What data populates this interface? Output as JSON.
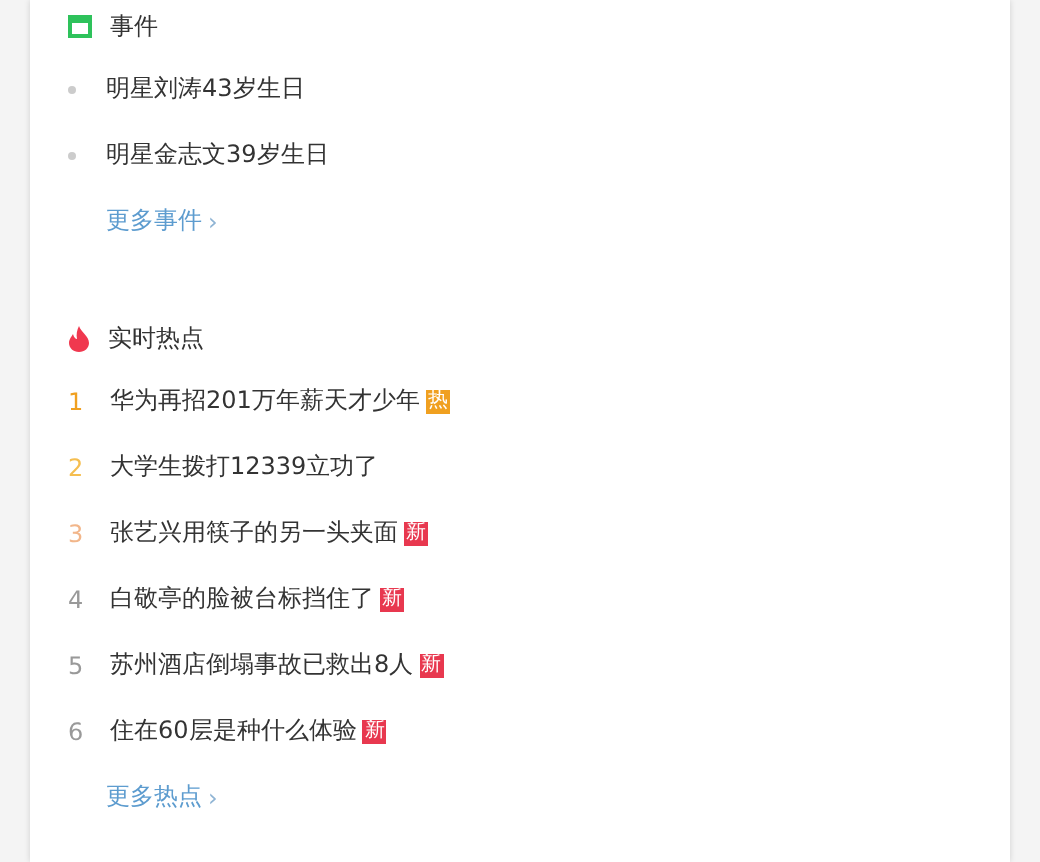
{
  "events": {
    "title": "事件",
    "items": [
      "明星刘涛43岁生日",
      "明星金志文39岁生日"
    ],
    "more": "更多事件",
    "more_arrow": "›"
  },
  "hot": {
    "title": "实时热点",
    "items": [
      {
        "rank": "1",
        "color": "#f0a020",
        "text": "华为再招201万年薪天才少年",
        "badge": {
          "kind": "hot",
          "text": "热"
        }
      },
      {
        "rank": "2",
        "color": "#f5be50",
        "text": "大学生拨打12339立功了"
      },
      {
        "rank": "3",
        "color": "#f2b68a",
        "text": "张艺兴用筷子的另一头夹面",
        "badge": {
          "kind": "new",
          "text": "新"
        }
      },
      {
        "rank": "4",
        "color": "#999999",
        "text": "白敬亭的脸被台标挡住了",
        "badge": {
          "kind": "new",
          "text": "新"
        }
      },
      {
        "rank": "5",
        "color": "#999999",
        "text": "苏州酒店倒塌事故已救出8人",
        "badge": {
          "kind": "new",
          "text": "新"
        }
      },
      {
        "rank": "6",
        "color": "#999999",
        "text": "住在60层是种什么体验",
        "badge": {
          "kind": "new",
          "text": "新"
        }
      }
    ],
    "more": "更多热点",
    "more_arrow": "›"
  }
}
